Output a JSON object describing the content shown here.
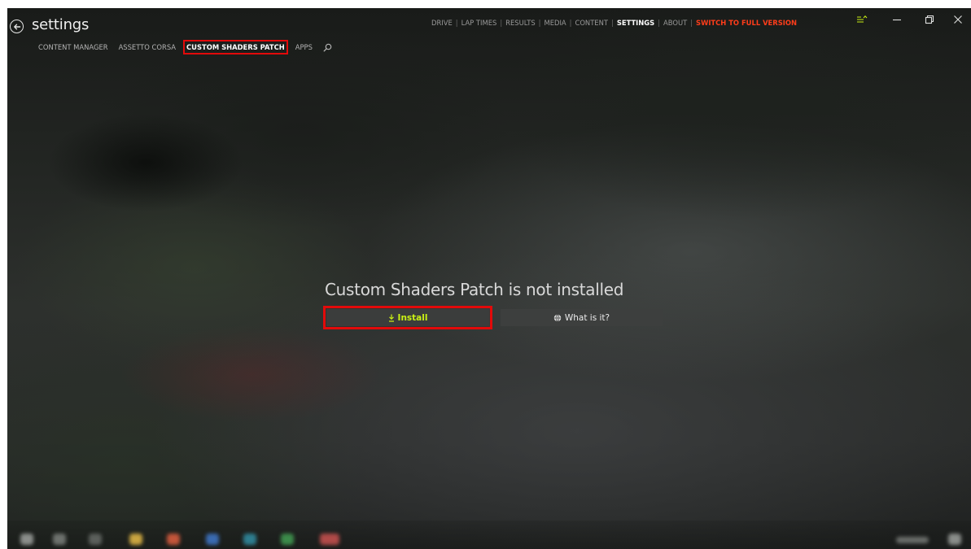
{
  "window": {
    "title": "settings"
  },
  "icons": {
    "back": "back-arrow-circle-icon",
    "search": "search-icon",
    "menu": "menu-lines-icon",
    "minimize": "minimize-icon",
    "restore": "restore-icon",
    "close": "close-icon",
    "download": "download-icon",
    "globe": "globe-icon"
  },
  "subtabs": [
    {
      "label": "CONTENT MANAGER"
    },
    {
      "label": "ASSETTO CORSA"
    },
    {
      "label": "CUSTOM SHADERS PATCH"
    },
    {
      "label": "APPS"
    }
  ],
  "topnav": [
    {
      "label": "DRIVE"
    },
    {
      "label": "LAP TIMES"
    },
    {
      "label": "RESULTS"
    },
    {
      "label": "MEDIA"
    },
    {
      "label": "CONTENT"
    },
    {
      "label": "SETTINGS"
    },
    {
      "label": "ABOUT"
    },
    {
      "label": "SWITCH TO FULL VERSION"
    }
  ],
  "main": {
    "message": "Custom Shaders Patch is not installed",
    "install_label": "Install",
    "whatis_label": "What is it?"
  },
  "colors": {
    "accent_orange": "#ff3d1a",
    "install_green": "#c9f014",
    "highlight_red": "#e20a0a"
  }
}
